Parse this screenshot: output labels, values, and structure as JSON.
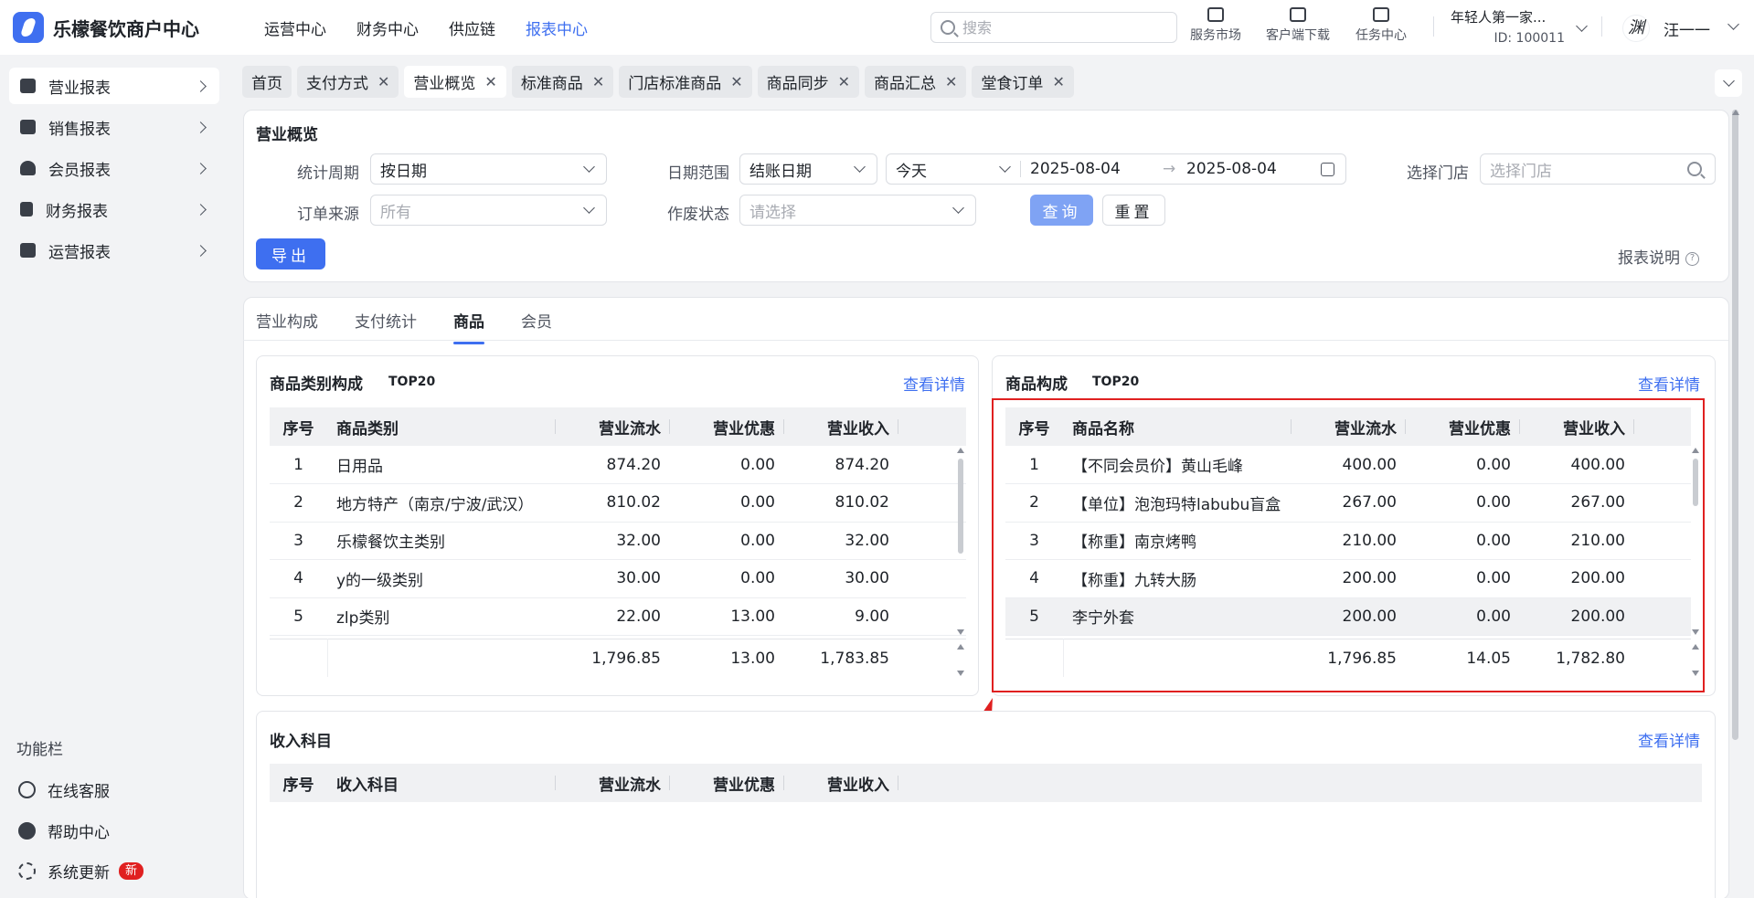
{
  "app": {
    "title": "乐檬餐饮商户中心"
  },
  "nav": {
    "items": [
      "运营中心",
      "财务中心",
      "供应链",
      "报表中心"
    ],
    "active_index": 3
  },
  "search": {
    "placeholder": "搜索"
  },
  "tools": {
    "service": "服务市场",
    "download": "客户端下载",
    "tasks": "任务中心"
  },
  "account": {
    "name": "年轻人第一家...",
    "id": "ID: 100011"
  },
  "user": {
    "avatar_char": "渊",
    "name": "汪一一"
  },
  "sidebar": {
    "items": [
      {
        "label": "营业报表",
        "icon": "store-icon"
      },
      {
        "label": "销售报表",
        "icon": "bank-icon"
      },
      {
        "label": "会员报表",
        "icon": "user-icon"
      },
      {
        "label": "财务报表",
        "icon": "receipt-icon"
      },
      {
        "label": "运营报表",
        "icon": "box-icon"
      }
    ],
    "section_title": "功能栏",
    "functions": [
      {
        "label": "在线客服",
        "icon": "support-icon"
      },
      {
        "label": "帮助中心",
        "icon": "help-icon"
      },
      {
        "label": "系统更新",
        "icon": "refresh-icon",
        "badge": "新"
      }
    ]
  },
  "tabs": [
    "首页",
    "支付方式",
    "营业概览",
    "标准商品",
    "门店标准商品",
    "商品同步",
    "商品汇总",
    "堂食订单"
  ],
  "filter": {
    "title": "营业概览",
    "period_label": "统计周期",
    "period_value": "按日期",
    "range_label": "日期范围",
    "range_type": "结账日期",
    "range_preset": "今天",
    "date_start": "2025-08-04",
    "date_sep": "→",
    "date_end": "2025-08-04",
    "store_label": "选择门店",
    "store_placeholder": "选择门店",
    "source_label": "订单来源",
    "source_placeholder": "所有",
    "void_label": "作废状态",
    "void_placeholder": "请选择",
    "query_btn": "查询",
    "reset_btn": "重置",
    "export_btn": "导出",
    "report_help": "报表说明"
  },
  "subtabs": [
    "营业构成",
    "支付统计",
    "商品",
    "会员"
  ],
  "category_panel": {
    "title": "商品类别构成",
    "top": "TOP20",
    "link": "查看详情",
    "headers": [
      "序号",
      "商品类别",
      "营业流水",
      "营业优惠",
      "营业收入"
    ],
    "rows": [
      [
        "1",
        "日用品",
        "874.20",
        "0.00",
        "874.20"
      ],
      [
        "2",
        "地方特产（南京/宁波/武汉）",
        "810.02",
        "0.00",
        "810.02"
      ],
      [
        "3",
        "乐檬餐饮主类别",
        "32.00",
        "0.00",
        "32.00"
      ],
      [
        "4",
        "y的一级类别",
        "30.00",
        "0.00",
        "30.00"
      ],
      [
        "5",
        "zlp类别",
        "22.00",
        "13.00",
        "9.00"
      ]
    ],
    "totals": [
      "1,796.85",
      "13.00",
      "1,783.85"
    ]
  },
  "product_panel": {
    "title": "商品构成",
    "top": "TOP20",
    "link": "查看详情",
    "headers": [
      "序号",
      "商品名称",
      "营业流水",
      "营业优惠",
      "营业收入"
    ],
    "rows": [
      [
        "1",
        "【不同会员价】黄山毛峰",
        "400.00",
        "0.00",
        "400.00"
      ],
      [
        "2",
        "【单位】泡泡玛特labubu盲盒",
        "267.00",
        "0.00",
        "267.00"
      ],
      [
        "3",
        "【称重】南京烤鸭",
        "210.00",
        "0.00",
        "210.00"
      ],
      [
        "4",
        "【称重】九转大肠",
        "200.00",
        "0.00",
        "200.00"
      ],
      [
        "5",
        "李宁外套",
        "200.00",
        "0.00",
        "200.00"
      ]
    ],
    "totals": [
      "1,796.85",
      "14.05",
      "1,782.80"
    ]
  },
  "income_panel": {
    "title": "收入科目",
    "link": "查看详情",
    "headers": [
      "序号",
      "收入科目",
      "营业流水",
      "营业优惠",
      "营业收入"
    ]
  }
}
